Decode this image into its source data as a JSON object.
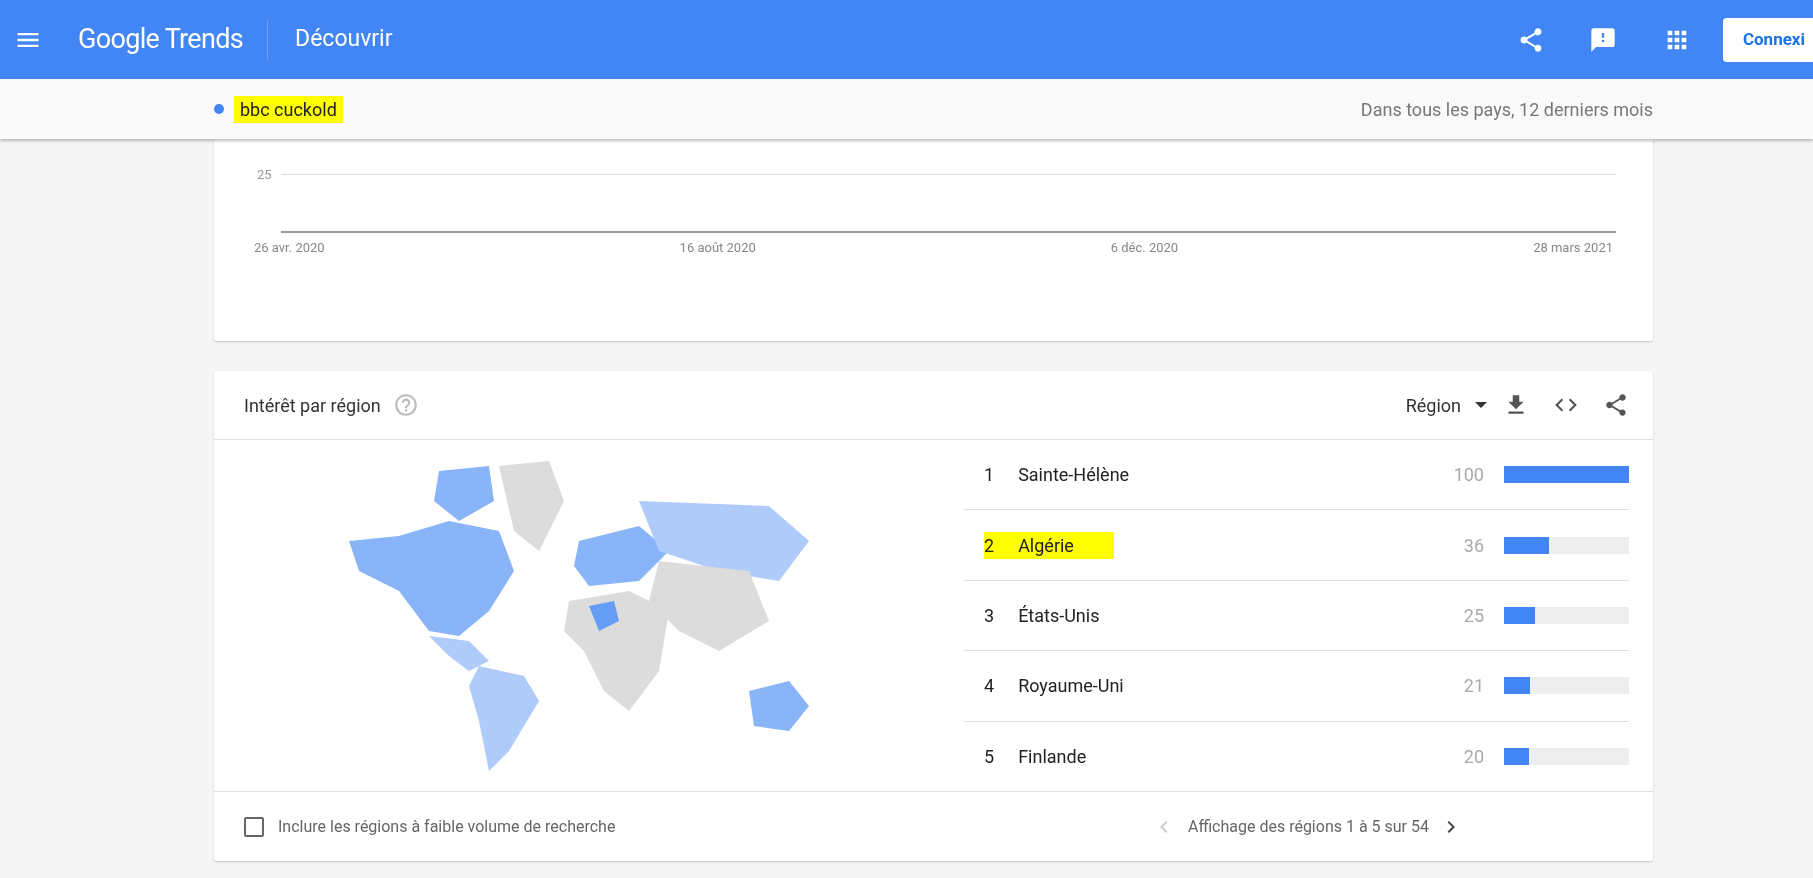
{
  "header": {
    "logo": "Google Trends",
    "page_title": "Découvrir",
    "signin_button": "Connexi"
  },
  "term_bar": {
    "term": {
      "label": "bbc cuckold",
      "color": "#4285f4",
      "highlighted": true
    },
    "scope": "Dans tous les pays, 12 derniers mois"
  },
  "timeline": {
    "y_tick": "25",
    "x_labels": [
      "26 avr. 2020",
      "16 août 2020",
      "6 déc. 2020",
      "28 mars 2021"
    ]
  },
  "region_card": {
    "title": "Intérêt par région",
    "resolution": "Région",
    "rows": [
      {
        "rank": "1",
        "name": "Sainte-Hélène",
        "value": "100",
        "level": 1.0,
        "highlighted": false
      },
      {
        "rank": "2",
        "name": "Algérie",
        "value": "36",
        "level": 0.36,
        "highlighted": true
      },
      {
        "rank": "3",
        "name": "États-Unis",
        "value": "25",
        "level": 0.25,
        "highlighted": false
      },
      {
        "rank": "4",
        "name": "Royaume-Uni",
        "value": "21",
        "level": 0.21,
        "highlighted": false
      },
      {
        "rank": "5",
        "name": "Finlande",
        "value": "20",
        "level": 0.2,
        "highlighted": false
      }
    ],
    "low_volume": {
      "label": "Inclure les régions à faible volume de recherche",
      "checked": false
    },
    "pagination": "Affichage des régions 1 à 5 sur 54"
  }
}
